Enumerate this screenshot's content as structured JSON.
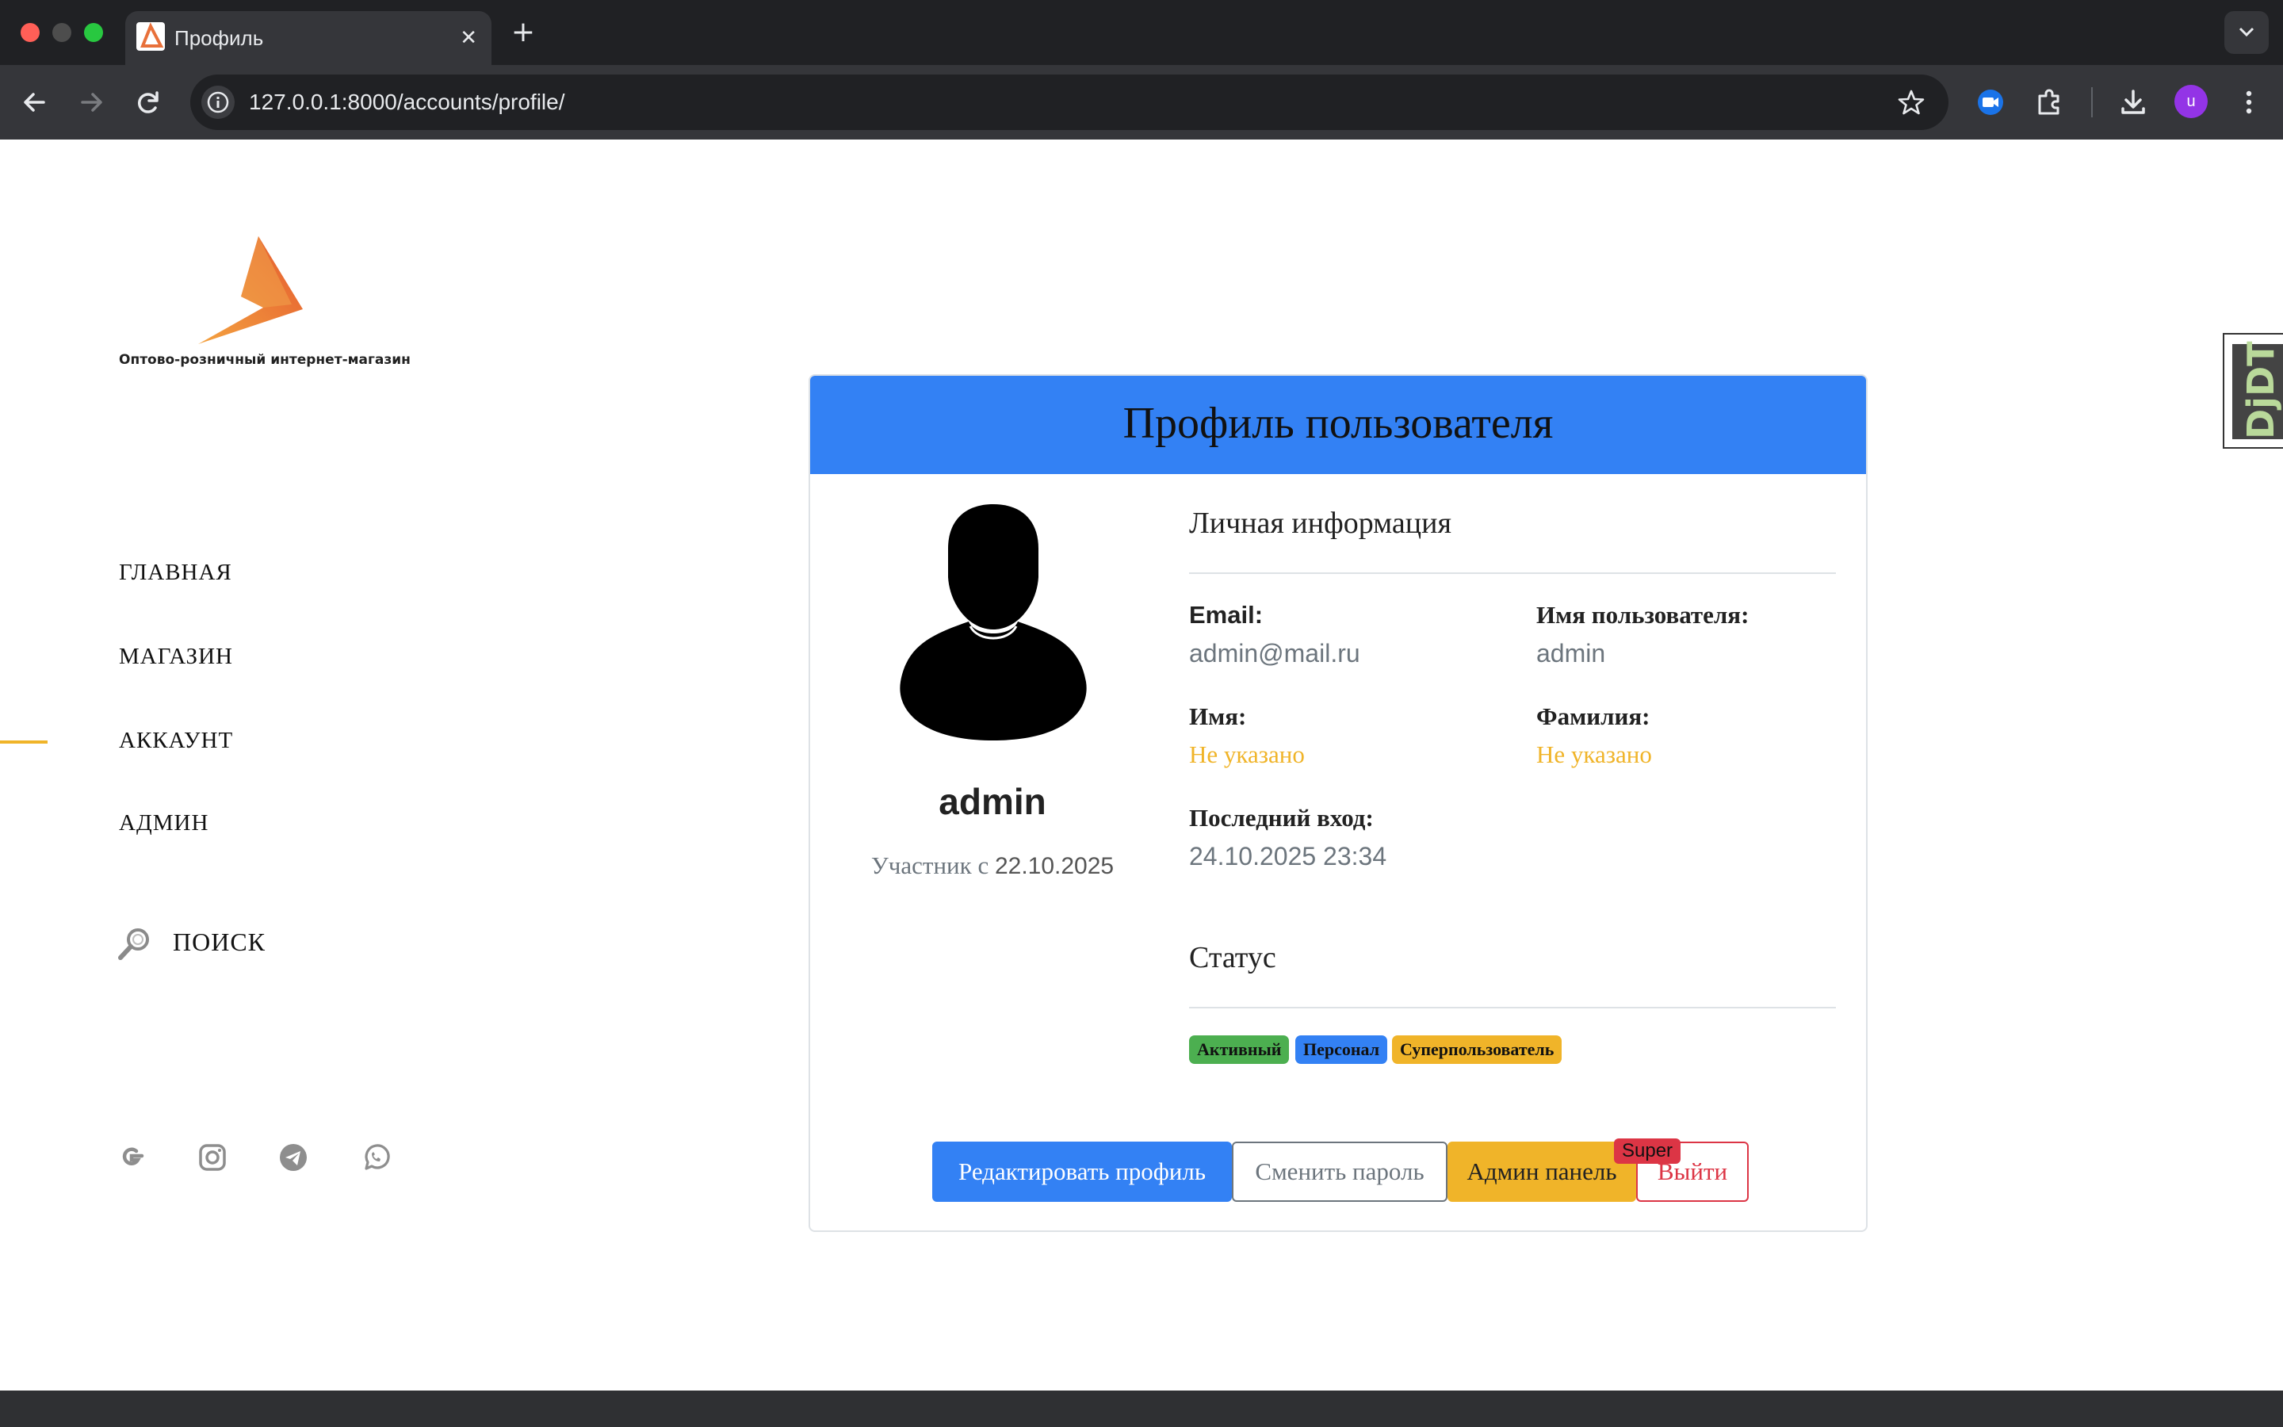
{
  "browser": {
    "tab_title": "Профиль",
    "tab_close": "✕",
    "new_tab": "+",
    "url": "127.0.0.1:8000/accounts/profile/",
    "profile_initial": "u"
  },
  "sidebar": {
    "logo_caption": "Оптово-розничный интернет-магазин",
    "nav": [
      {
        "label": "ГЛАВНАЯ",
        "active": false
      },
      {
        "label": "МАГАЗИН",
        "active": false
      },
      {
        "label": "АККАУНТ",
        "active": true
      },
      {
        "label": "АДМИН",
        "active": false
      }
    ],
    "search_label": "ПОИСК",
    "socials": [
      "google-icon",
      "instagram-icon",
      "telegram-icon",
      "whatsapp-icon"
    ]
  },
  "profile": {
    "title": "Профиль пользователя",
    "username_display": "admin",
    "member_since_label": "Участник с",
    "member_since_date": "22.10.2025",
    "personal_section": "Личная информация",
    "email_label": "Email:",
    "email_value": "admin@mail.ru",
    "username_label": "Имя пользователя:",
    "username_value": "admin",
    "first_name_label": "Имя:",
    "first_name_value": "Не указано",
    "last_name_label": "Фамилия:",
    "last_name_value": "Не указано",
    "last_login_label": "Последний вход:",
    "last_login_value": "24.10.2025 23:34",
    "status_section": "Статус",
    "badges": {
      "active": "Активный",
      "staff": "Персонал",
      "superuser": "Суперпользователь"
    },
    "buttons": {
      "edit": "Редактировать профиль",
      "change_password": "Сменить пароль",
      "admin_panel": "Админ панель",
      "super_tag": "Super",
      "logout": "Выйти"
    }
  },
  "debug_toolbar": {
    "label": "DjDT"
  },
  "colors": {
    "primary": "#3381f4",
    "warning": "#f0b429",
    "success": "#4caf50",
    "danger": "#dc3545",
    "muted": "#6c757d"
  }
}
